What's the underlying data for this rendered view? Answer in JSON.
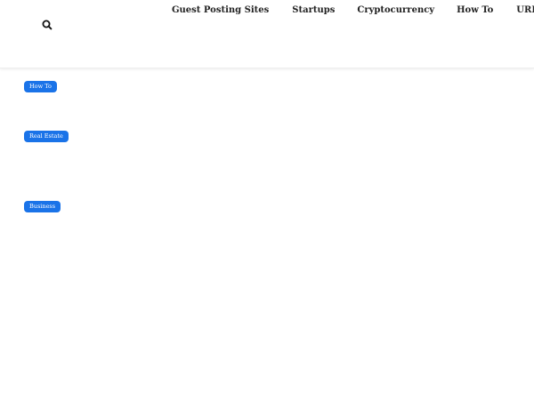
{
  "header": {
    "search_icon": "search-icon",
    "nav": [
      {
        "label": "Guest Posting Sites"
      },
      {
        "label": "Startups"
      },
      {
        "label": "Cryptocurrency"
      },
      {
        "label": "How To"
      },
      {
        "label": "URL Shortener"
      }
    ]
  },
  "feed": {
    "posts": [
      {
        "category": "How To",
        "title": "",
        "meta": ""
      },
      {
        "category": "Real Estate",
        "title": "",
        "meta": ""
      },
      {
        "category": "Business",
        "title": "",
        "meta": ""
      }
    ]
  },
  "colors": {
    "badge_bg": "#1a73e8",
    "badge_text": "#ffffff",
    "nav_text": "#222222",
    "faded_text": "#f3f5f8"
  }
}
